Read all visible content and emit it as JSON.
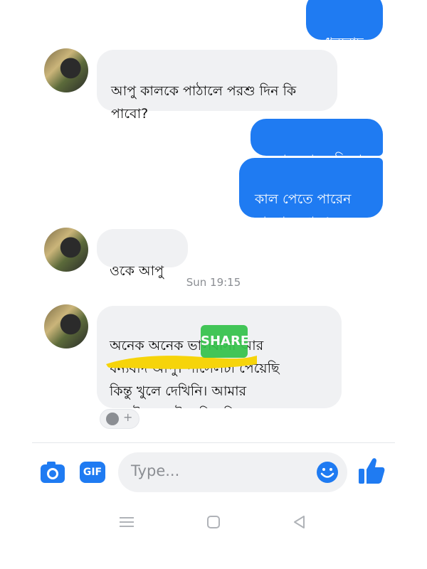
{
  "messages": {
    "m1": "ধন্যবাদ",
    "m2": "আপু কালকে পাঠালে পরশু দিন কি\nপাবো?",
    "m3": "আজ রাতে দিবো",
    "m4": "কাল পেতে পারেন\nনা পেলে পরশু",
    "m5": "ওকে আপু",
    "m6": "অনেক অনেক ভালবাসা আর\nধন্যবাদ আপু। পার্সেলটা পেয়েছি\nকিন্তু খুলে দেখিনি। আমার\nছোটো মেয়েটা খুবি খুশি হয়েছে।"
  },
  "timestamp": "Sun 19:15",
  "watermark": "SHARE",
  "reaction_plus": "+",
  "composer": {
    "gif_label": "GIF",
    "placeholder": "Type..."
  },
  "icons": {
    "camera": "camera-icon",
    "gif": "gif-icon",
    "emoji": "emoji-icon",
    "like": "thumbs-up-icon",
    "add_reaction": "add-reaction-icon",
    "nav_menu": "menu-icon",
    "nav_home": "home-icon",
    "nav_back": "back-icon"
  },
  "colors": {
    "outgoing": "#1f7bf2",
    "incoming": "#f0f1f3",
    "accent": "#1f7bf2"
  }
}
